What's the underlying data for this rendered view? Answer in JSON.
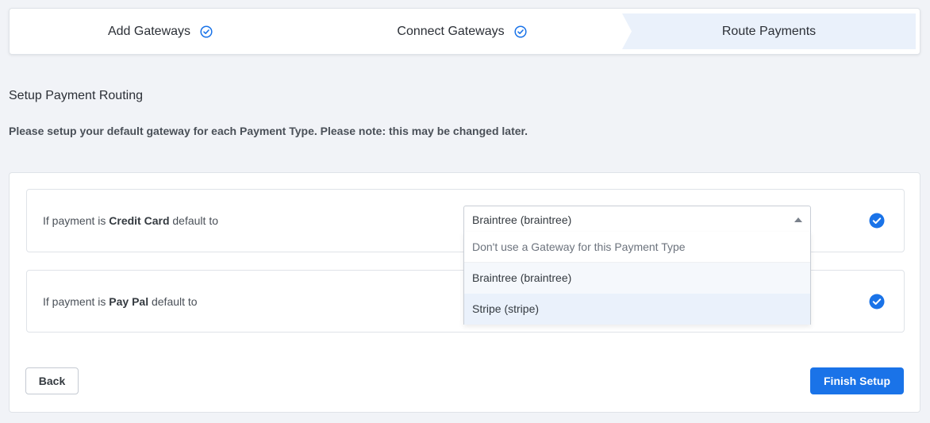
{
  "stepper": {
    "steps": [
      {
        "label": "Add Gateways",
        "status": "complete",
        "icon": "check-circle-outline-icon"
      },
      {
        "label": "Connect Gateways",
        "status": "complete",
        "icon": "check-circle-outline-icon"
      },
      {
        "label": "Route Payments",
        "status": "active"
      }
    ]
  },
  "heading": "Setup Payment Routing",
  "subtext": "Please setup your default gateway for each Payment Type. Please note: this may be changed later.",
  "routes": [
    {
      "prefix": "If payment is ",
      "payment_type": "Credit Card",
      "suffix": " default to",
      "icon": "check-circle-filled-icon"
    },
    {
      "prefix": "If payment is ",
      "payment_type": "Pay Pal",
      "suffix": " default to",
      "icon": "check-circle-filled-icon"
    }
  ],
  "gateway_select": {
    "value": "Braintree (braintree)",
    "options": [
      "Don't use a Gateway for this Payment Type",
      "Braintree (braintree)",
      "Stripe (stripe)"
    ]
  },
  "buttons": {
    "back": "Back",
    "finish": "Finish Setup"
  },
  "colors": {
    "accent": "#1a73e8",
    "active_step_bg": "#eaf1fb",
    "page_bg": "#f1f3f7"
  }
}
